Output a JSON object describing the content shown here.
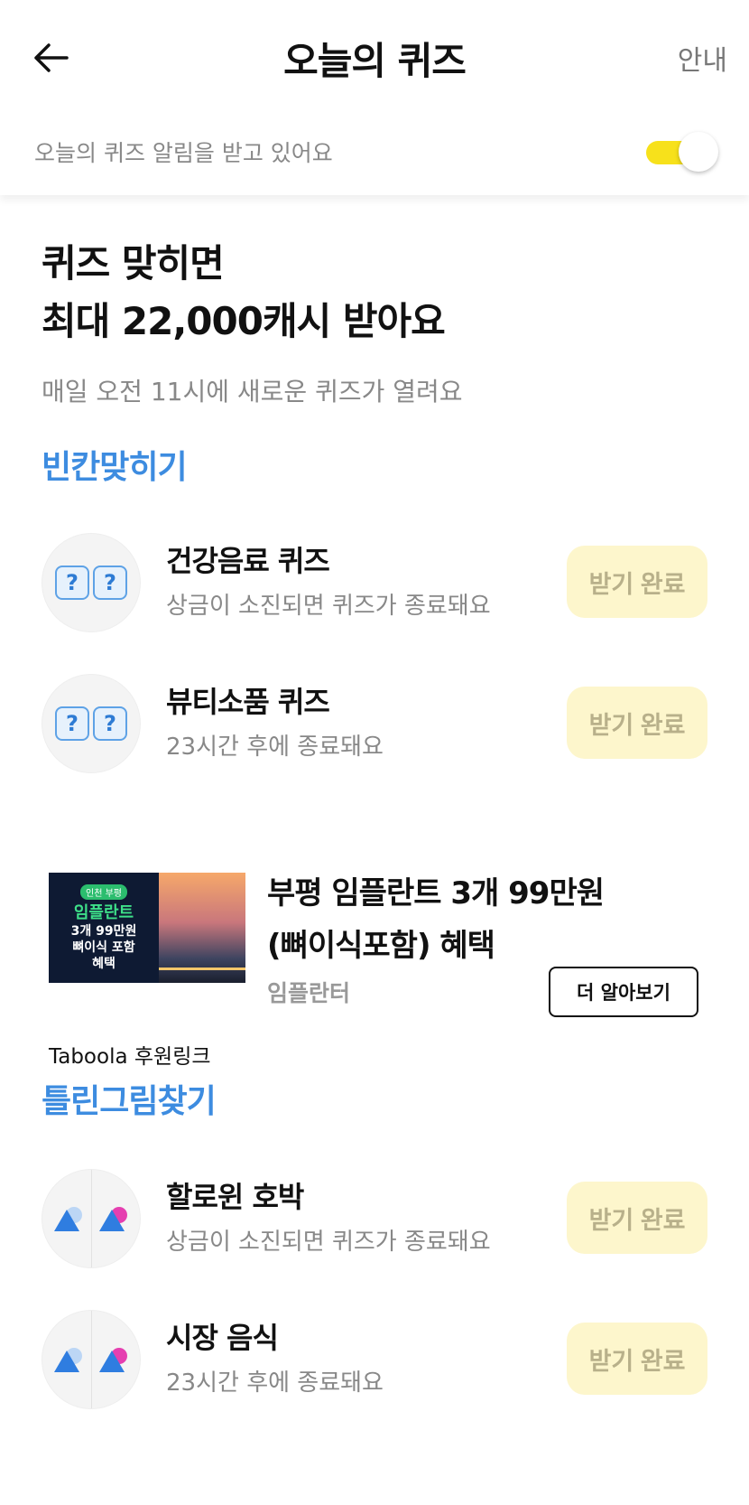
{
  "header": {
    "title": "오늘의 퀴즈",
    "guide": "안내",
    "back_icon": "arrow-left-icon"
  },
  "notice": {
    "text": "오늘의 퀴즈 알림을 받고 있어요",
    "toggle_on": true,
    "toggle_color": "#f7e11b"
  },
  "hero": {
    "line1": "퀴즈 맞히면",
    "line2": "최대 22,000캐시 받아요",
    "subtitle": "매일 오전 11시에 새로운 퀴즈가 열려요"
  },
  "sections": [
    {
      "title": "빈칸맞히기",
      "items": [
        {
          "title": "건강음료 퀴즈",
          "desc": "상금이 소진되면 퀴즈가 종료돼요",
          "button": "받기 완료",
          "icon": "question-boxes-icon"
        },
        {
          "title": "뷰티소품 퀴즈",
          "desc": "23시간 후에 종료돼요",
          "button": "받기 완료",
          "icon": "question-boxes-icon"
        }
      ]
    },
    {
      "title": "틀린그림찾기",
      "items": [
        {
          "title": "할로윈 호박",
          "desc": "상금이 소진되면 퀴즈가 종료돼요",
          "button": "받기 완료",
          "icon": "spot-difference-icon"
        },
        {
          "title": "시장 음식",
          "desc": "23시간 후에 종료돼요",
          "button": "받기 완료",
          "icon": "spot-difference-icon"
        }
      ]
    }
  ],
  "ad": {
    "title_line1": "부평 임플란트 3개 99만원",
    "title_line2": "(뼈이식포함) 혜택",
    "advertiser": "임플란터",
    "cta": "더 알아보기",
    "sponsor": "Taboola 후원링크",
    "image": {
      "badge": "인천 부평",
      "title": "임플란트",
      "line1": "3개 99만원",
      "line2": "뼈이식 포함",
      "line3": "혜택"
    }
  },
  "colors": {
    "accent_blue": "#3d8ce0",
    "button_bg": "#fdf6cc",
    "button_text": "#b8b08a"
  }
}
